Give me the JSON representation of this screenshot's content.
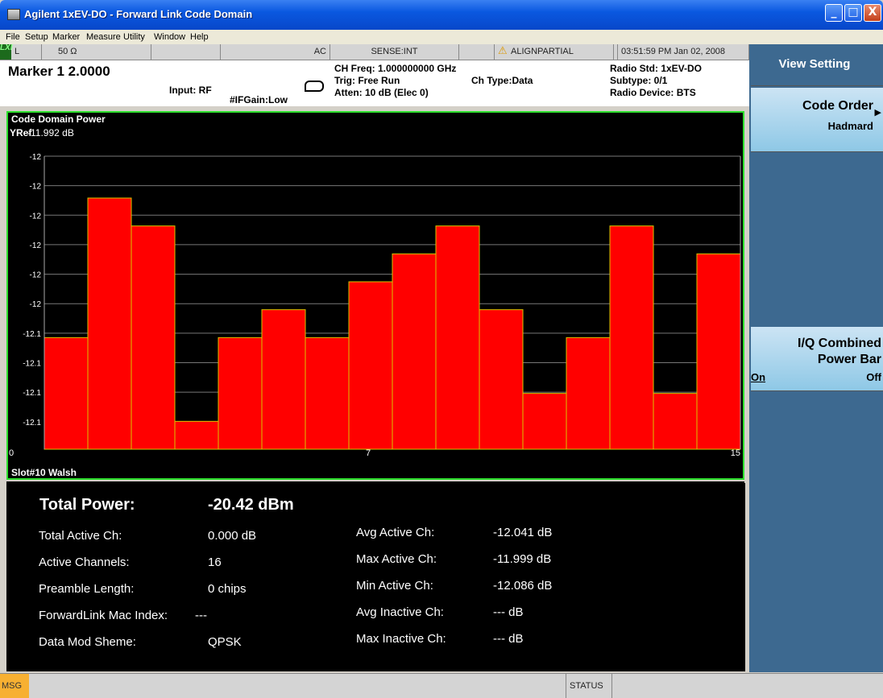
{
  "window": {
    "title": "Agilent 1xEV-DO - Forward Link Code Domain",
    "min": "_",
    "max": "□",
    "close": "X"
  },
  "menu": [
    "File",
    "Setup",
    "Marker",
    "Measure",
    "Utility",
    "Window",
    "Help"
  ],
  "status_strip": {
    "lxi": "LXI",
    "l": "L",
    "impedance": "50 Ω",
    "coupling": "AC",
    "sense": "SENSE:INT",
    "align": "ALIGNPARTIAL",
    "time": "03:51:59 PM Jan 02, 2008"
  },
  "header": {
    "marker": "Marker 1  2.0000",
    "input": "Input: RF",
    "ifgain": "#IFGain:Low",
    "ch_freq": "CH Freq: 1.000000000 GHz",
    "trig": "Trig: Free Run",
    "atten": "Atten: 10 dB (Elec 0)",
    "ch_type": "Ch Type:Data",
    "radio_std": "Radio Std: 1xEV-DO",
    "subtype": "Subtype: 0/1",
    "radio_device": "Radio Device: BTS"
  },
  "plot": {
    "title": "Code Domain Power",
    "yref_label": "YRef",
    "yref_value": "-11.992 dB",
    "slot": "Slot#10   Walsh"
  },
  "chart_data": {
    "type": "bar",
    "title": "Code Domain Power",
    "x": [
      0,
      1,
      2,
      3,
      4,
      5,
      6,
      7,
      8,
      9,
      10,
      11,
      12,
      13,
      14,
      15
    ],
    "values": [
      -12.06,
      -12.01,
      -12.02,
      -12.09,
      -12.06,
      -12.05,
      -12.06,
      -12.04,
      -12.03,
      -12.02,
      -12.05,
      -12.08,
      -12.06,
      -12.02,
      -12.08,
      -12.03
    ],
    "ytick_labels": [
      "-12",
      "-12",
      "-12",
      "-12",
      "-12",
      "-12",
      "-12.1",
      "-12.1",
      "-12.1",
      "-12.1"
    ],
    "xtick_labels": [
      "0",
      "7",
      "15"
    ],
    "bar_color": "#ff0000",
    "bar_edge": "#d9c400",
    "grid": true
  },
  "results": {
    "total_power_label": "Total Power:",
    "total_power_value": "-20.42 dBm",
    "rows_left": [
      {
        "label": "Total Active Ch:",
        "value": "0.000 dB"
      },
      {
        "label": "Active Channels:",
        "value": "16"
      },
      {
        "label": "Preamble Length:",
        "value": "0 chips"
      },
      {
        "label": "ForwardLink Mac Index:",
        "value": "---"
      },
      {
        "label": "Data Mod Sheme:",
        "value": "QPSK"
      }
    ],
    "rows_right": [
      {
        "label": "Avg Active Ch:",
        "value": "-12.041 dB"
      },
      {
        "label": "Max Active Ch:",
        "value": "-11.999 dB"
      },
      {
        "label": "Min Active Ch:",
        "value": "-12.086 dB"
      },
      {
        "label": "Avg Inactive Ch:",
        "value": "--- dB"
      },
      {
        "label": "Max Inactive Ch:",
        "value": "--- dB"
      }
    ]
  },
  "softkeys": {
    "menu_title": "View Setting",
    "code_order_label": "Code Order",
    "code_order_value": "Hadmard",
    "iq_label1": "I/Q Combined",
    "iq_label2": "Power Bar",
    "iq_on": "On",
    "iq_off": "Off"
  },
  "bottom": {
    "msg": "MSG",
    "status": "STATUS"
  },
  "colors": {
    "accent": "#2ee02e",
    "softkey": "#3d6990"
  }
}
